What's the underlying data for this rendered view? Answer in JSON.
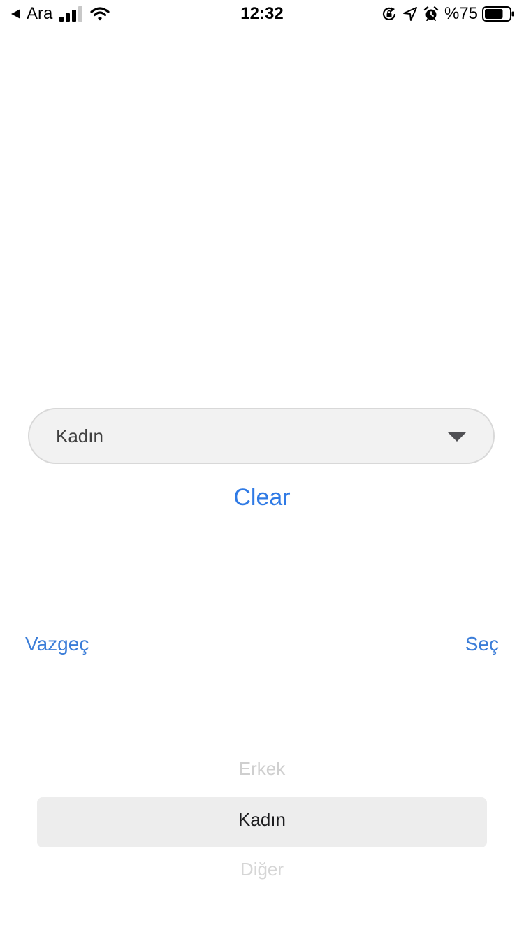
{
  "status_bar": {
    "back_icon": "back-triangle-icon",
    "carrier": "Ara",
    "time": "12:32",
    "battery_percent": "%75",
    "battery_level": 0.75,
    "icons": [
      "signal-bars-icon",
      "wifi-icon",
      "rotation-lock-icon",
      "location-arrow-icon",
      "alarm-clock-icon",
      "battery-icon"
    ]
  },
  "dropdown": {
    "value": "Kadın",
    "caret_icon": "caret-down-icon"
  },
  "clear_label": "Clear",
  "picker": {
    "cancel_label": "Vazgeç",
    "done_label": "Seç",
    "options": [
      "Erkek",
      "Kadın",
      "Diğer"
    ],
    "selected": "Kadın"
  },
  "colors": {
    "accent": "#2f7ae5",
    "toolbar_link": "#3b7dd8",
    "dropdown_bg": "#f2f2f2",
    "dropdown_border": "#d8d8d8",
    "picker_highlight": "#ededed"
  }
}
